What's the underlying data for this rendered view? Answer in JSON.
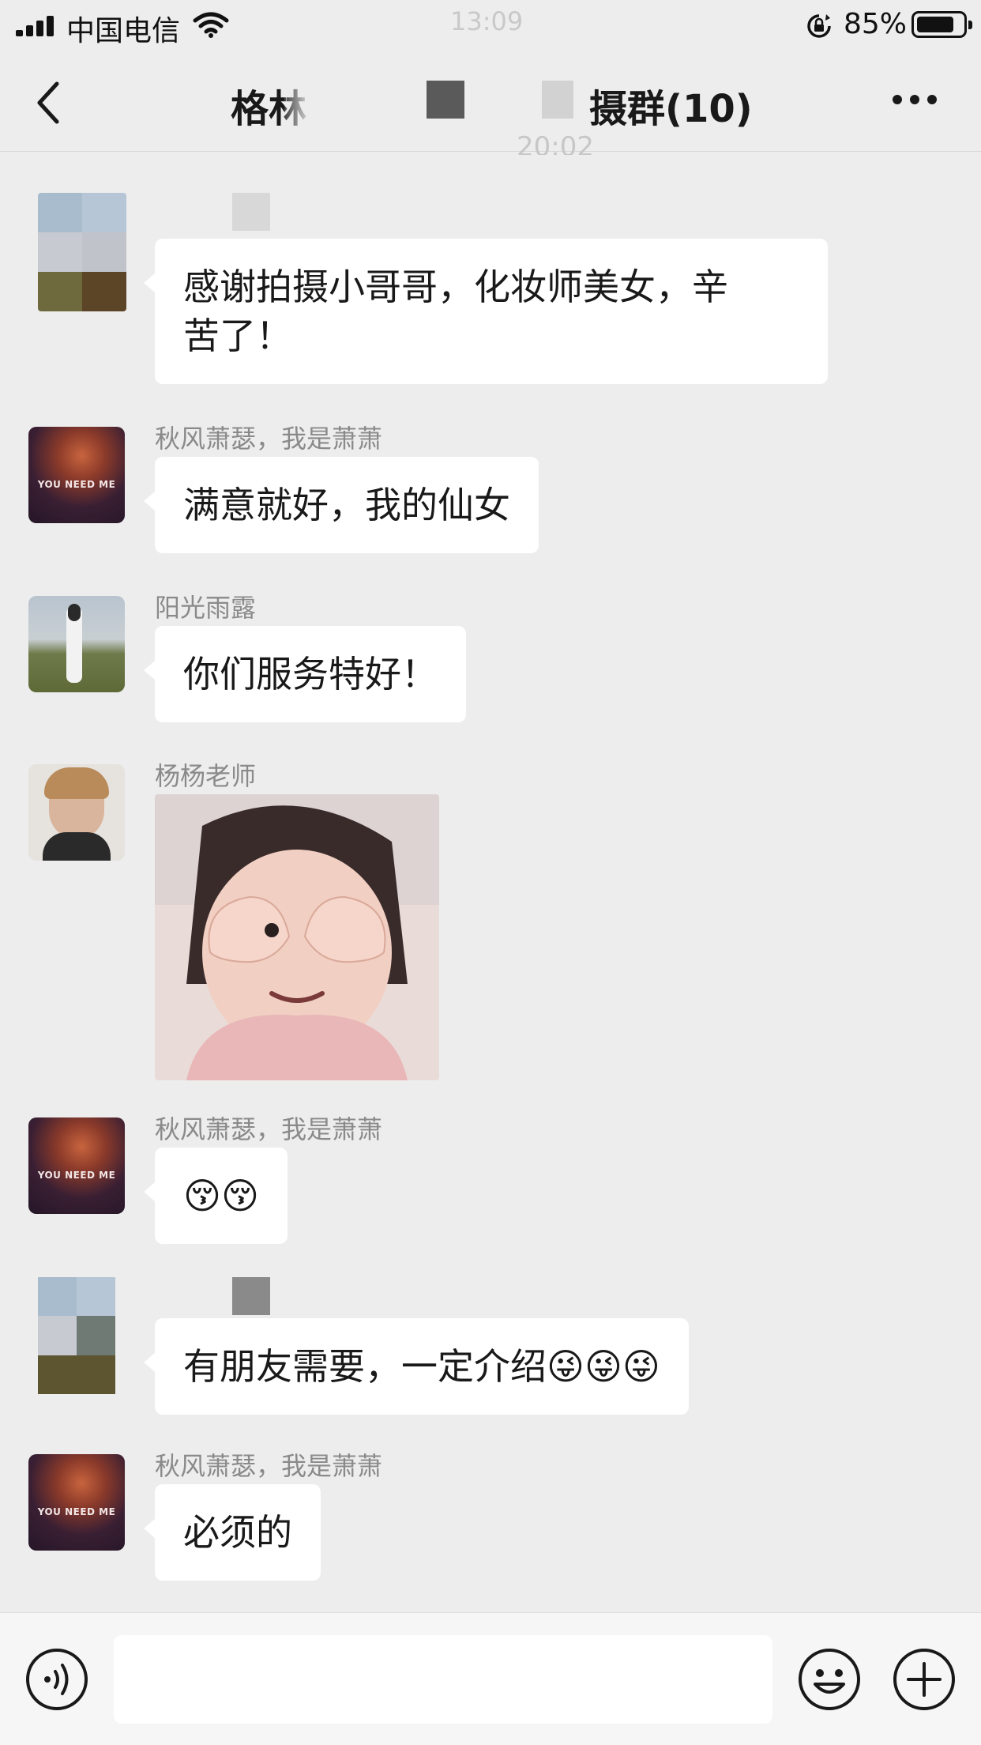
{
  "status_bar": {
    "carrier": "中国电信",
    "time": "13:09",
    "battery": "85%"
  },
  "nav": {
    "title_left": "格林",
    "title_right": "摄群(10)"
  },
  "timestamp": "20:02",
  "messages": [
    {
      "sender": "",
      "text": "感谢拍摄小哥哥，化妆师美女，辛\n苦了！"
    },
    {
      "sender": "秋风萧瑟，我是萧萧",
      "text": "满意就好，我的仙女"
    },
    {
      "sender": "阳光雨露",
      "text": "你们服务特好！"
    },
    {
      "sender": "杨杨老师",
      "text": ""
    },
    {
      "sender": "秋风萧瑟，我是萧萧",
      "text": "😚😚"
    },
    {
      "sender": "",
      "text": "有朋友需要，一定介绍😜😜😜"
    },
    {
      "sender": "秋风萧瑟，我是萧萧",
      "text": "必须的"
    }
  ],
  "avatar_cover_text": "YOU NEED ME",
  "input": {
    "placeholder": ""
  },
  "colors": {
    "background": "#ededed",
    "bubble": "#ffffff",
    "input_bar": "#f6f6f6"
  },
  "icons": {
    "back": "chevron-left-icon",
    "more": "more-dots-icon",
    "voice": "voice-icon",
    "emoji": "emoji-icon",
    "plus": "plus-icon"
  }
}
